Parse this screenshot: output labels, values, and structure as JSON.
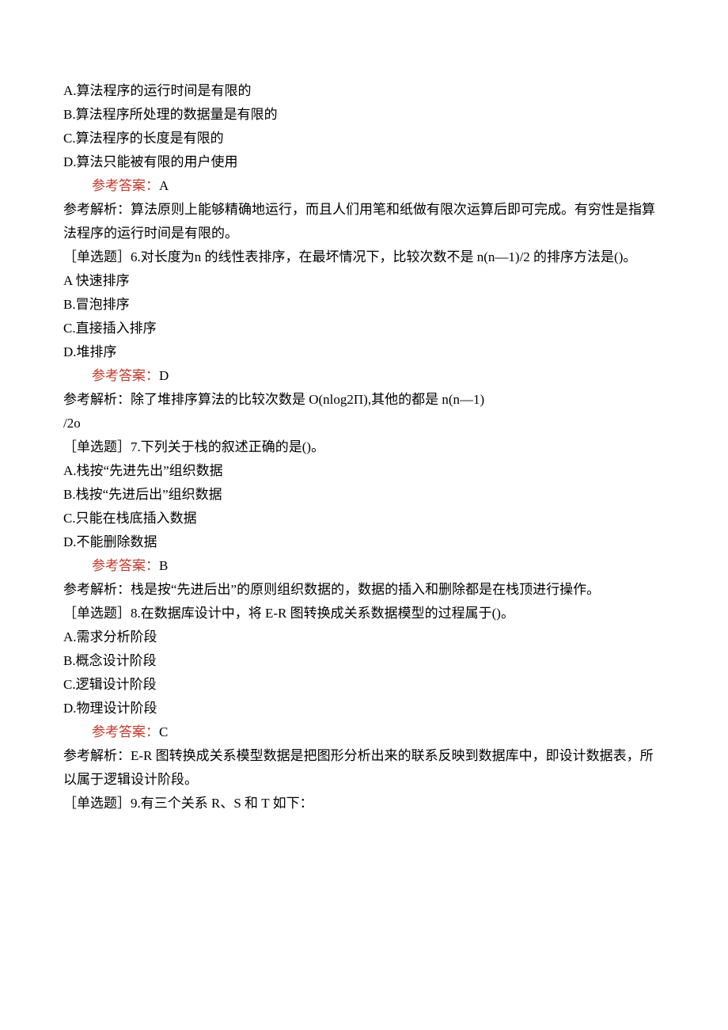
{
  "q5": {
    "optA": "A.算法程序的运行时间是有限的",
    "optB": "B.算法程序所处理的数据量是有限的",
    "optC": "C.算法程序的长度是有限的",
    "optD": "D.算法只能被有限的用户使用",
    "answer_label": "参考答案：",
    "answer_value": "A",
    "explain": "参考解析：算法原则上能够精确地运行，而且人们用笔和纸做有限次运算后即可完成。有穷性是指算法程序的运行时间是有限的。"
  },
  "q6": {
    "prompt": "［单选题］6.对长度为n 的线性表排序，在最坏情况下，比较次数不是 n(n—1)/2 的排序方法是()。",
    "optA": "A 快速排序",
    "optB": "B.冒泡排序",
    "optC": "C.直接插入排序",
    "optD": "D.堆排序",
    "answer_label": "参考答案：",
    "answer_value": "D",
    "explain_l1": "参考解析：除了堆排序算法的比较次数是 O(nlog2Π),其他的都是 n(n—1)",
    "explain_l2": "/2o"
  },
  "q7": {
    "prompt": "［单选题］7.下列关于栈的叙述正确的是()。",
    "optA": "A.栈按“先进先出”组织数据",
    "optB": "B.栈按“先进后出”组织数据",
    "optC": "C.只能在栈底插入数据",
    "optD": "D.不能删除数据",
    "answer_label": "参考答案：",
    "answer_value": "B",
    "explain": "参考解析：栈是按“先进后出”的原则组织数据的，数据的插入和删除都是在栈顶进行操作。"
  },
  "q8": {
    "prompt": "［单选题］8.在数据库设计中，将 E-R 图转换成关系数据模型的过程属于()。",
    "optA": "A.需求分析阶段",
    "optB": "B.概念设计阶段",
    "optC": "C.逻辑设计阶段",
    "optD": "D.物理设计阶段",
    "answer_label": "参考答案：",
    "answer_value": "C",
    "explain": "参考解析：E-R 图转换成关系模型数据是把图形分析出来的联系反映到数据库中，即设计数据表，所以属于逻辑设计阶段。"
  },
  "q9": {
    "prompt": "［单选题］9.有三个关系 R、S 和 T 如下："
  }
}
